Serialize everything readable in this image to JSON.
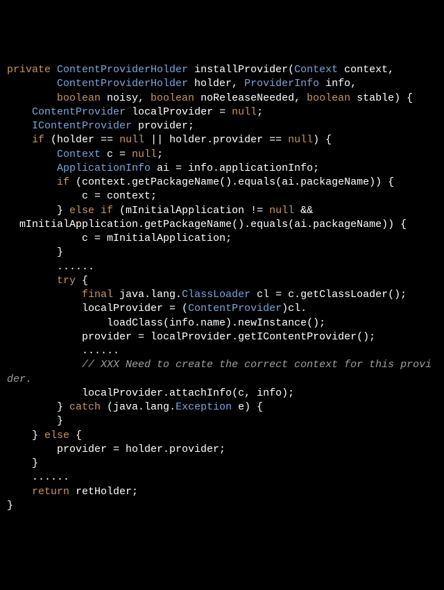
{
  "tokens": [
    {
      "cls": "kw",
      "t": "private"
    },
    {
      "cls": "plain",
      "t": " "
    },
    {
      "cls": "type",
      "t": "ContentProviderHolder"
    },
    {
      "cls": "plain",
      "t": " installProvider("
    },
    {
      "cls": "type",
      "t": "Context"
    },
    {
      "cls": "plain",
      "t": " context,\n        "
    },
    {
      "cls": "type",
      "t": "ContentProviderHolder"
    },
    {
      "cls": "plain",
      "t": " holder, "
    },
    {
      "cls": "type",
      "t": "ProviderInfo"
    },
    {
      "cls": "plain",
      "t": " info,\n        "
    },
    {
      "cls": "kw",
      "t": "boolean"
    },
    {
      "cls": "plain",
      "t": " noisy, "
    },
    {
      "cls": "kw",
      "t": "boolean"
    },
    {
      "cls": "plain",
      "t": " noReleaseNeeded, "
    },
    {
      "cls": "kw",
      "t": "boolean"
    },
    {
      "cls": "plain",
      "t": " stable) {\n    "
    },
    {
      "cls": "type",
      "t": "ContentProvider"
    },
    {
      "cls": "plain",
      "t": " localProvider = "
    },
    {
      "cls": "kw",
      "t": "null"
    },
    {
      "cls": "plain",
      "t": ";\n    "
    },
    {
      "cls": "type",
      "t": "IContentProvider"
    },
    {
      "cls": "plain",
      "t": " provider;\n    "
    },
    {
      "cls": "kw",
      "t": "if"
    },
    {
      "cls": "plain",
      "t": " (holder == "
    },
    {
      "cls": "kw",
      "t": "null"
    },
    {
      "cls": "plain",
      "t": " || holder.provider == "
    },
    {
      "cls": "kw",
      "t": "null"
    },
    {
      "cls": "plain",
      "t": ") {\n        "
    },
    {
      "cls": "type",
      "t": "Context"
    },
    {
      "cls": "plain",
      "t": " c = "
    },
    {
      "cls": "kw",
      "t": "null"
    },
    {
      "cls": "plain",
      "t": ";\n        "
    },
    {
      "cls": "type",
      "t": "ApplicationInfo"
    },
    {
      "cls": "plain",
      "t": " ai = info.applicationInfo;\n        "
    },
    {
      "cls": "kw",
      "t": "if"
    },
    {
      "cls": "plain",
      "t": " (context.getPackageName().equals(ai.packageName)) {\n            c = context;\n        } "
    },
    {
      "cls": "kw",
      "t": "else if"
    },
    {
      "cls": "plain",
      "t": " (mInitialApplication != "
    },
    {
      "cls": "kw",
      "t": "null"
    },
    {
      "cls": "plain",
      "t": " &&\n  mInitialApplication.getPackageName().equals(ai.packageName)) {\n            c = mInitialApplication;\n        }\n        ......\n        "
    },
    {
      "cls": "kw",
      "t": "try"
    },
    {
      "cls": "plain",
      "t": " {\n            "
    },
    {
      "cls": "kw",
      "t": "final"
    },
    {
      "cls": "plain",
      "t": " java.lang."
    },
    {
      "cls": "type",
      "t": "ClassLoader"
    },
    {
      "cls": "plain",
      "t": " cl = c.getClassLoader();\n            localProvider = ("
    },
    {
      "cls": "type",
      "t": "ContentProvider"
    },
    {
      "cls": "plain",
      "t": ")cl.\n                loadClass(info.name).newInstance();\n            provider = localProvider.getIContentProvider();\n            ......\n            "
    },
    {
      "cls": "str",
      "t": "// XXX Need to create the correct context for this provider."
    },
    {
      "cls": "plain",
      "t": "\n            localProvider.attachInfo(c, info);\n        } "
    },
    {
      "cls": "kw",
      "t": "catch"
    },
    {
      "cls": "plain",
      "t": " (java.lang."
    },
    {
      "cls": "type",
      "t": "Exception"
    },
    {
      "cls": "plain",
      "t": " e) {\n        }\n    } "
    },
    {
      "cls": "kw",
      "t": "else"
    },
    {
      "cls": "plain",
      "t": " {\n        provider = holder.provider;\n    }\n    ......\n    "
    },
    {
      "cls": "kw",
      "t": "return"
    },
    {
      "cls": "plain",
      "t": " retHolder;\n}"
    }
  ]
}
